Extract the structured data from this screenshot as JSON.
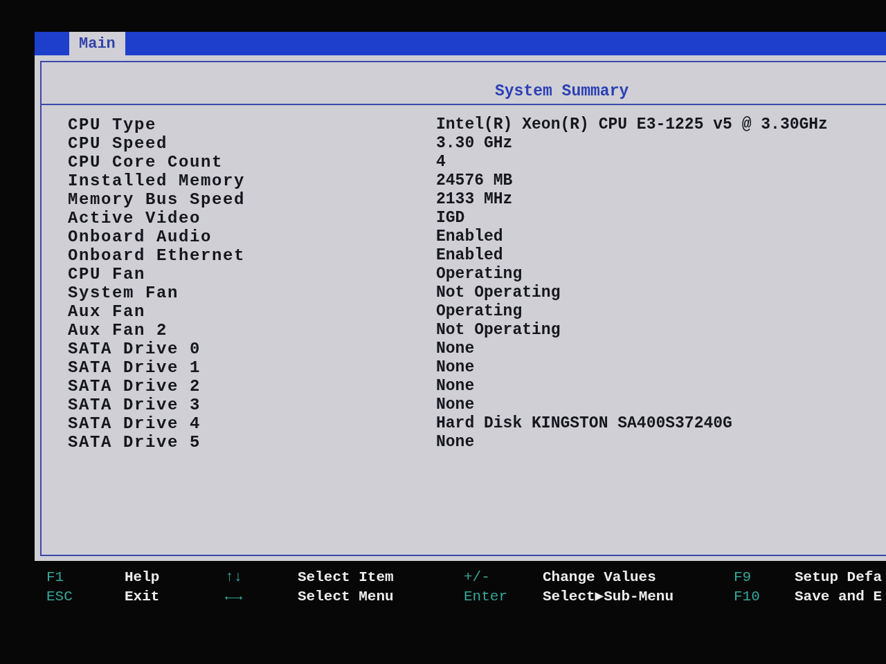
{
  "tabs": [
    {
      "label": "Main",
      "selected": true
    }
  ],
  "section_title": "System Summary",
  "rows": [
    {
      "label": "CPU Type",
      "value": "Intel(R) Xeon(R) CPU E3-1225 v5 @ 3.30GHz"
    },
    {
      "label": "CPU Speed",
      "value": "3.30 GHz"
    },
    {
      "label": "CPU Core Count",
      "value": "4"
    },
    {
      "label": "Installed Memory",
      "value": "24576 MB"
    },
    {
      "label": "Memory Bus Speed",
      "value": "2133 MHz"
    },
    {
      "label": "Active Video",
      "value": "IGD"
    },
    {
      "label": "Onboard Audio",
      "value": "Enabled"
    },
    {
      "label": "Onboard Ethernet",
      "value": "Enabled"
    },
    {
      "label": "CPU Fan",
      "value": "Operating"
    },
    {
      "label": "System Fan",
      "value": "Not Operating"
    },
    {
      "label": "Aux Fan",
      "value": "Operating"
    },
    {
      "label": "Aux Fan 2",
      "value": "Not Operating"
    },
    {
      "label": "SATA Drive 0",
      "value": "None"
    },
    {
      "label": "SATA Drive 1",
      "value": "None"
    },
    {
      "label": "SATA Drive 2",
      "value": "None"
    },
    {
      "label": "SATA Drive 3",
      "value": "None"
    },
    {
      "label": "SATA Drive 4",
      "value": "Hard Disk KINGSTON SA400S37240G"
    },
    {
      "label": "SATA Drive 5",
      "value": "None"
    }
  ],
  "help_bar": [
    {
      "items": [
        {
          "key": "F1",
          "action": "Help"
        },
        {
          "key": "ESC",
          "action": "Exit"
        }
      ]
    },
    {
      "items": [
        {
          "key": "↑↓",
          "action": "Select Item"
        },
        {
          "key": "←→",
          "action": "Select Menu"
        }
      ]
    },
    {
      "items": [
        {
          "key": "+/-",
          "action": "Change Values"
        },
        {
          "key": "Enter",
          "action": "Select▶Sub-Menu"
        }
      ]
    },
    {
      "items": [
        {
          "key": "F9",
          "action": "Setup Defa"
        },
        {
          "key": "F10",
          "action": "Save and E"
        }
      ]
    }
  ]
}
